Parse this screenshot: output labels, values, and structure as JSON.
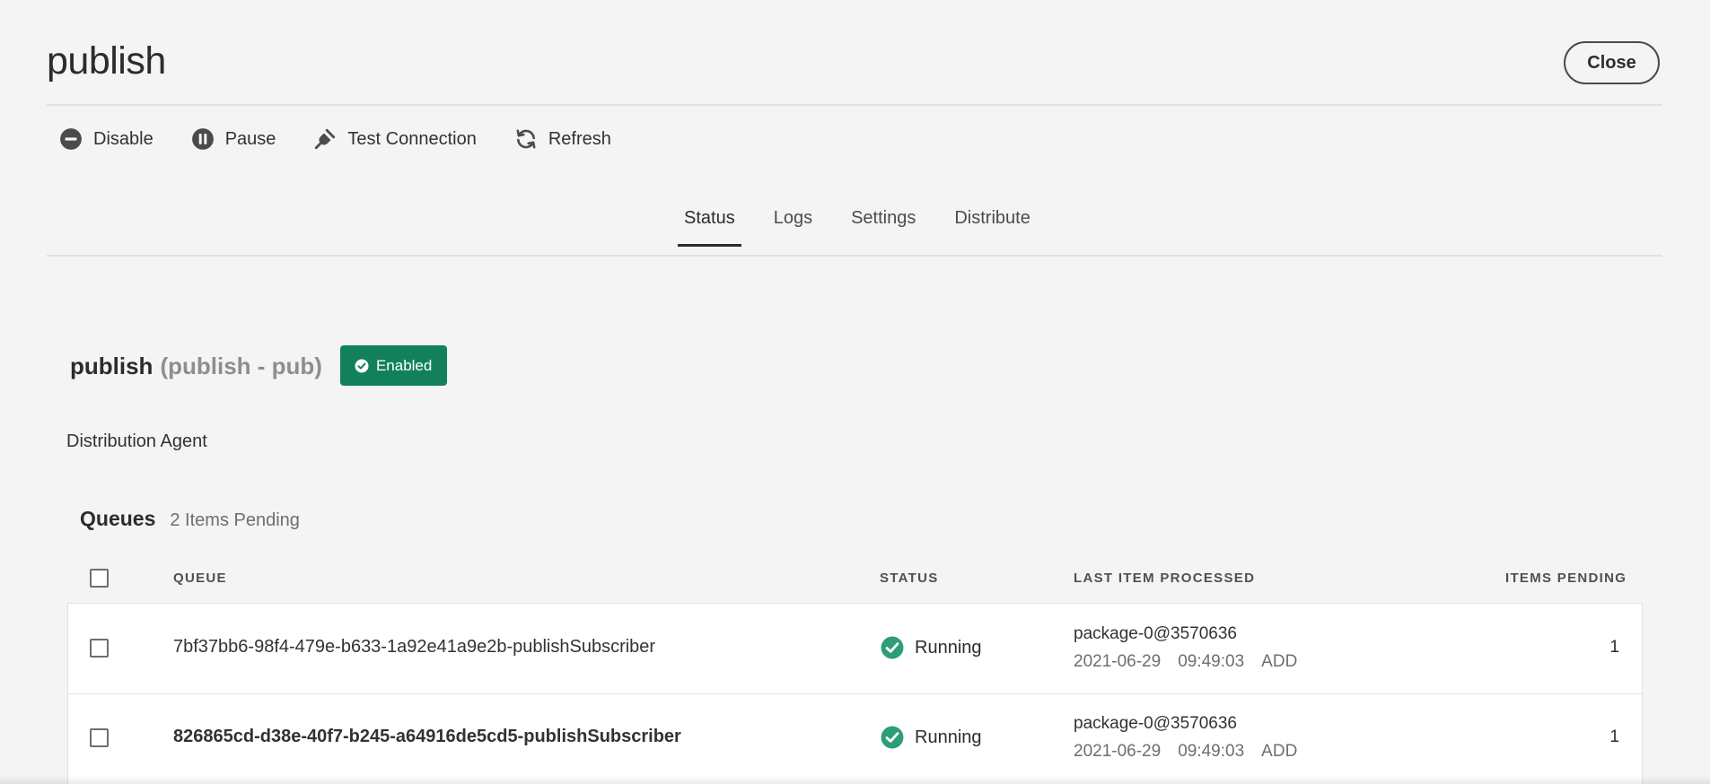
{
  "header": {
    "title": "publish",
    "close_label": "Close"
  },
  "toolbar": {
    "disable_label": "Disable",
    "pause_label": "Pause",
    "test_connection_label": "Test Connection",
    "refresh_label": "Refresh"
  },
  "tabs": [
    {
      "label": "Status",
      "active": true
    },
    {
      "label": "Logs",
      "active": false
    },
    {
      "label": "Settings",
      "active": false
    },
    {
      "label": "Distribute",
      "active": false
    }
  ],
  "agent": {
    "name": "publish",
    "subtitle": "(publish - pub)",
    "status_badge": "Enabled",
    "type": "Distribution Agent"
  },
  "queues": {
    "title": "Queues",
    "pending_summary": "2 Items Pending",
    "columns": {
      "queue": "QUEUE",
      "status": "STATUS",
      "last_item": "LAST ITEM PROCESSED",
      "items_pending": "ITEMS PENDING"
    },
    "rows": [
      {
        "queue": "7bf37bb6-98f4-479e-b633-1a92e41a9e2b-publishSubscriber",
        "status": "Running",
        "last_package": "package-0@3570636",
        "last_date": "2021-06-29",
        "last_time": "09:49:03",
        "last_action": "ADD",
        "pending": "1"
      },
      {
        "queue": "826865cd-d38e-40f7-b245-a64916de5cd5-publishSubscriber",
        "status": "Running",
        "last_package": "package-0@3570636",
        "last_date": "2021-06-29",
        "last_time": "09:49:03",
        "last_action": "ADD",
        "pending": "1"
      }
    ]
  },
  "colors": {
    "badge_green": "#12805c",
    "running_green": "#2d9d78"
  }
}
